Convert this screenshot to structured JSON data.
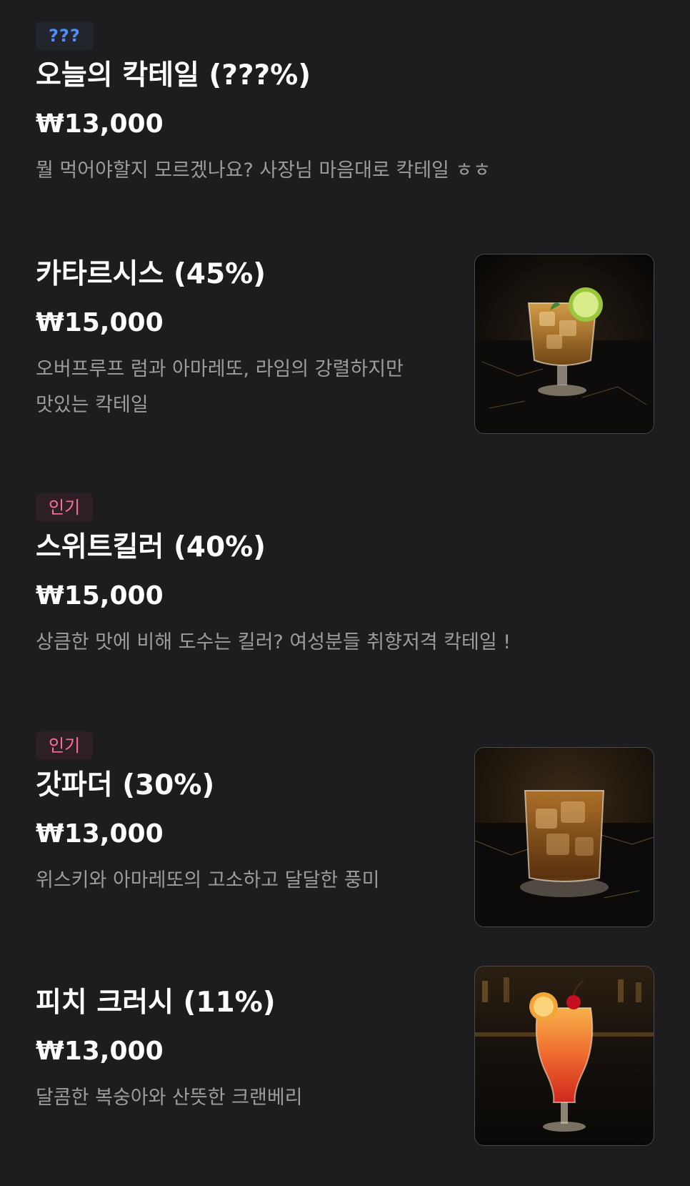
{
  "menu": {
    "items": [
      {
        "badge": "???",
        "name": "오늘의 칵테일 (???%)",
        "price": "₩13,000",
        "description": "뭘 먹어야할지 모르겠나요? 사장님 마음대로 칵테일 ㅎㅎ"
      },
      {
        "name": "카타르시스 (45%)",
        "price": "₩15,000",
        "description": "오버프루프 럼과 아마레또, 라임의 강렬하지만 맛있는 칵테일",
        "image_icon": "rocks-glass-lime-icon"
      },
      {
        "badge": "인기",
        "name": "스위트킬러 (40%)",
        "price": "₩15,000",
        "description": "상큼한 맛에 비해 도수는 킬러? 여성분들 취향저격 칵테일 !"
      },
      {
        "badge": "인기",
        "name": "갓파더 (30%)",
        "price": "₩13,000",
        "description": "위스키와 아마레또의 고소하고 달달한 풍미",
        "image_icon": "whiskey-rocks-glass-icon"
      },
      {
        "name": "피치 크러시 (11%)",
        "price": "₩13,000",
        "description": "달콤한 복숭아와 산뜻한 크랜베리",
        "image_icon": "hurricane-glass-cherry-icon"
      }
    ]
  },
  "colors": {
    "background": "#1d1d20",
    "secret_badge_text": "#4f8df5",
    "popular_badge_text": "#ff6f9a",
    "description_text": "#9c9c9f"
  }
}
